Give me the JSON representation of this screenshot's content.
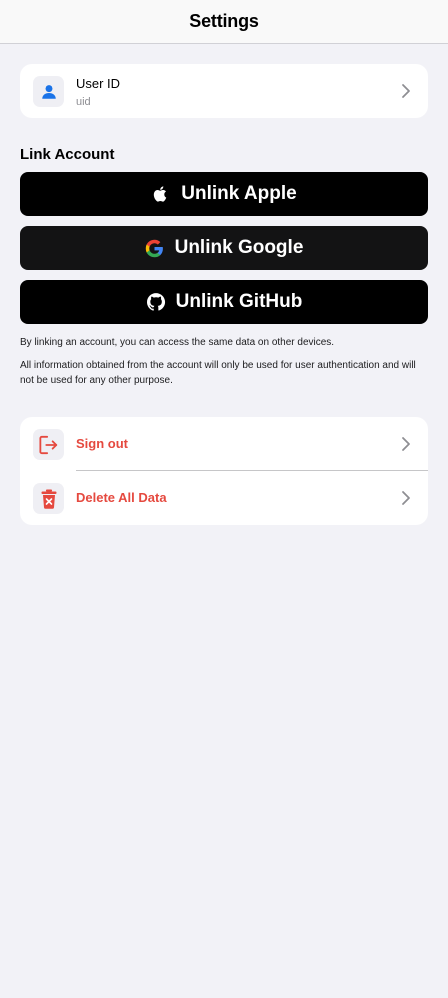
{
  "nav": {
    "title": "Settings"
  },
  "user": {
    "label": "User ID",
    "value": "uid",
    "icon": "person-icon"
  },
  "link_section": {
    "header": "Link Account",
    "buttons": [
      {
        "label": "Unlink Apple",
        "icon": "apple-icon"
      },
      {
        "label": "Unlink Google",
        "icon": "google-icon"
      },
      {
        "label": "Unlink GitHub",
        "icon": "github-icon"
      }
    ],
    "note1": "By linking an account, you can access the same data on other devices.",
    "note2": "All information obtained from the account will only be used for user authentication and will not be used for any other purpose."
  },
  "actions": {
    "sign_out": "Sign out",
    "delete_all": "Delete All Data"
  },
  "colors": {
    "background": "#f2f2f7",
    "accent_blue": "#1a73e8",
    "danger": "#e5493f"
  }
}
